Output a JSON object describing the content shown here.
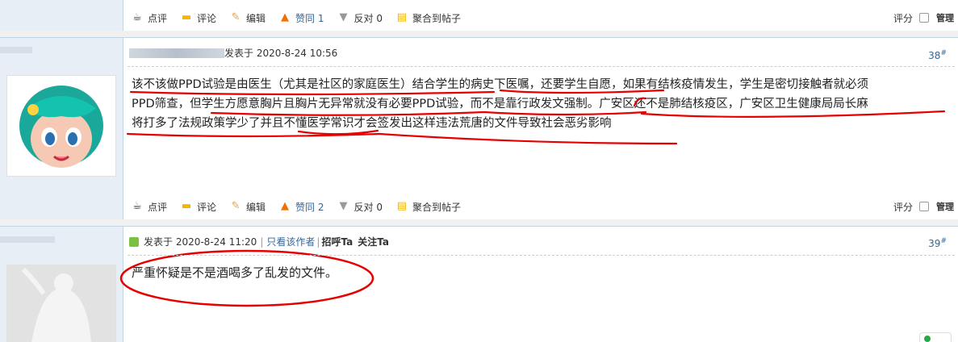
{
  "post_actions": {
    "rate": "点评",
    "comment": "评论",
    "edit": "编辑",
    "like_1": "赞同 1",
    "like_2": "赞同 2",
    "oppose": "反对 0",
    "gather": "聚合到帖子",
    "score": "评分",
    "manage": "管理"
  },
  "post_38": {
    "posted": "发表于 2020-8-24 10:56",
    "floor": "38",
    "floor_sup": "#",
    "line1": "该不该做PPD试验是由医生（尤其是社区的家庭医生）结合学生的病史下医嘱，还要学生自愿，如果有结核疫情发生，学生是密切接触者就必须",
    "line2": "PPD筛查，但学生方愿意胸片且胸片无异常就没有必要PPD试验，而不是靠行政发文强制。广安区还不是肺结核疫区，广安区卫生健康局局长麻",
    "line3": "将打多了法规政策学少了并且不懂医学常识才会签发出这样违法荒唐的文件导致社会恶劣影响"
  },
  "post_39": {
    "posted": "发表于 2020-8-24 11:20",
    "only_author": "只看该作者",
    "greet": "招呼Ta",
    "follow": "关注Ta",
    "floor": "39",
    "floor_sup": "#",
    "text": "严重怀疑是不是酒喝多了乱发的文件。"
  },
  "colors": {
    "border": "#c2d5e3",
    "sidebar": "#e8eef5",
    "annotation": "#e60000",
    "link": "#336699"
  }
}
